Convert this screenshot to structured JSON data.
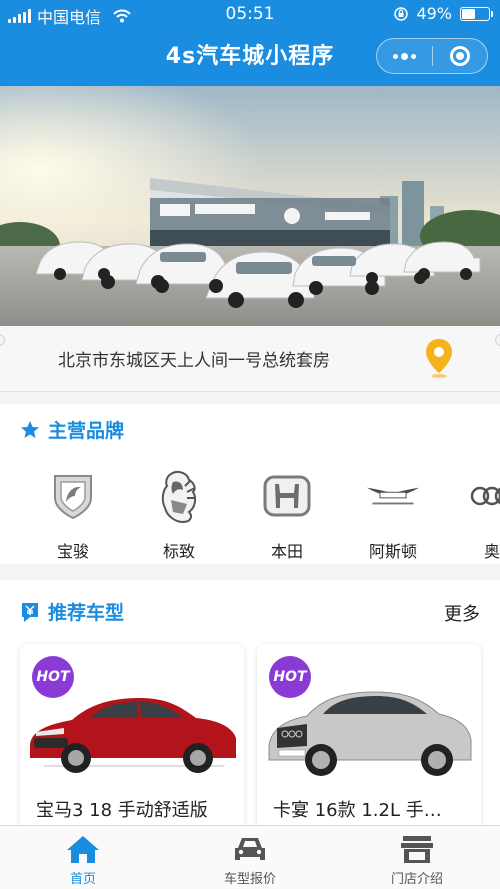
{
  "status_bar": {
    "carrier": "中国电信",
    "time": "05:51",
    "battery": "49%",
    "battery_level": 0.49
  },
  "nav": {
    "title": "4s汽车城小程序"
  },
  "address": {
    "text": "北京市东城区天上人间一号总统套房"
  },
  "brands": {
    "title": "主营品牌",
    "items": [
      {
        "name": "宝骏",
        "icon": "baojun-logo"
      },
      {
        "name": "标致",
        "icon": "peugeot-logo"
      },
      {
        "name": "本田",
        "icon": "honda-logo"
      },
      {
        "name": "阿斯顿",
        "icon": "aston-martin-logo"
      },
      {
        "name": "奥",
        "icon": "audi-logo"
      }
    ]
  },
  "recommend": {
    "title": "推荐车型",
    "more": "更多",
    "cards": [
      {
        "badge": "HOT",
        "name": "宝马3 18 手动舒适版",
        "color": "#b3141c"
      },
      {
        "badge": "HOT",
        "name": "卡宴 16款 1.2L 手…",
        "color": "#c8c8c8"
      }
    ]
  },
  "tabbar": {
    "items": [
      {
        "label": "首页",
        "icon": "home-icon",
        "active": true
      },
      {
        "label": "车型报价",
        "icon": "car-icon",
        "active": false
      },
      {
        "label": "门店介绍",
        "icon": "store-icon",
        "active": false
      }
    ],
    "active_color": "#1a8de0",
    "inactive_color": "#555555"
  },
  "colors": {
    "primary": "#1a8de0",
    "hot_badge": "#8a3bd6",
    "pin": "#f6b21a"
  }
}
